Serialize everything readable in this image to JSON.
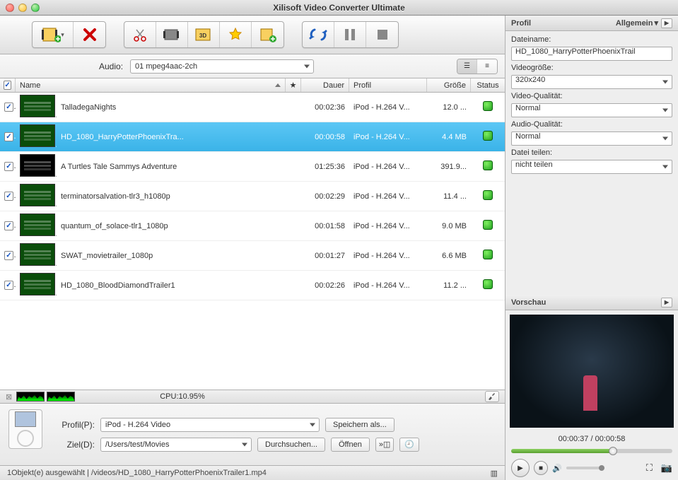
{
  "title": "Xilisoft Video Converter Ultimate",
  "audio": {
    "label": "Audio:",
    "value": "01 mpeg4aac-2ch"
  },
  "columns": {
    "name": "Name",
    "duration": "Dauer",
    "profile": "Profil",
    "size": "Größe",
    "status": "Status"
  },
  "files": [
    {
      "name": "TalladegaNights",
      "duration": "00:02:36",
      "profile": "iPod - H.264 V...",
      "size": "12.0 ...",
      "dark": false
    },
    {
      "name": "HD_1080_HarryPotterPhoenixTra...",
      "duration": "00:00:58",
      "profile": "iPod - H.264 V...",
      "size": "4.4 MB",
      "dark": false,
      "selected": true
    },
    {
      "name": "A Turtles Tale Sammys Adventure",
      "duration": "01:25:36",
      "profile": "iPod - H.264 V...",
      "size": "391.9...",
      "dark": true
    },
    {
      "name": "terminatorsalvation-tlr3_h1080p",
      "duration": "00:02:29",
      "profile": "iPod - H.264 V...",
      "size": "11.4 ...",
      "dark": false
    },
    {
      "name": "quantum_of_solace-tlr1_1080p",
      "duration": "00:01:58",
      "profile": "iPod - H.264 V...",
      "size": "9.0 MB",
      "dark": false
    },
    {
      "name": "SWAT_movietrailer_1080p",
      "duration": "00:01:27",
      "profile": "iPod - H.264 V...",
      "size": "6.6 MB",
      "dark": false
    },
    {
      "name": "HD_1080_BloodDiamondTrailer1",
      "duration": "00:02:26",
      "profile": "iPod - H.264 V...",
      "size": "11.2 ...",
      "dark": false
    }
  ],
  "cpu": {
    "label": "CPU:10.95%"
  },
  "bottom": {
    "profile_label": "Profil(P):",
    "profile_value": "iPod - H.264 Video",
    "save_as": "Speichern als...",
    "dest_label": "Ziel(D):",
    "dest_value": "/Users/test/Movies",
    "browse": "Durchsuchen...",
    "open": "Öffnen"
  },
  "status_bar": "1Objekt(e) ausgewählt | /videos/HD_1080_HarryPotterPhoenixTrailer1.mp4",
  "right": {
    "profile_head": "Profil",
    "general": "Allgemein",
    "filename_label": "Dateiname:",
    "filename_value": "HD_1080_HarryPotterPhoenixTrail",
    "videosize_label": "Videogröße:",
    "videosize_value": "320x240",
    "vquality_label": "Video-Qualität:",
    "vquality_value": "Normal",
    "aquality_label": "Audio-Qualität:",
    "aquality_value": "Normal",
    "split_label": "Datei teilen:",
    "split_value": "nicht teilen",
    "preview_head": "Vorschau",
    "time": "00:00:37 / 00:00:58"
  }
}
